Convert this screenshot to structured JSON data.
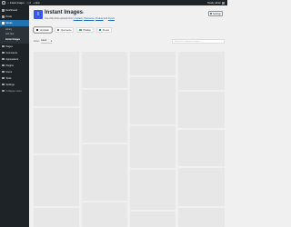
{
  "adminbar": {
    "site_name": "Instant Images",
    "comments_count": "0",
    "new_label": "+ New",
    "greeting": "Howdy, admin"
  },
  "sidebar": {
    "items": [
      {
        "label": "Dashboard",
        "icon": "dashboard-icon"
      },
      {
        "label": "Posts",
        "icon": "pin-icon"
      },
      {
        "label": "Media",
        "icon": "media-icon",
        "active": true,
        "submenu": [
          "Library",
          "Add New",
          "Instant Images"
        ],
        "current": 2
      },
      {
        "label": "Pages",
        "icon": "page-icon"
      },
      {
        "label": "Comments",
        "icon": "comment-icon"
      },
      {
        "label": "Appearance",
        "icon": "brush-icon"
      },
      {
        "label": "Plugins",
        "icon": "plug-icon"
      },
      {
        "label": "Users",
        "icon": "user-icon"
      },
      {
        "label": "Tools",
        "icon": "wrench-icon"
      },
      {
        "label": "Settings",
        "icon": "settings-icon"
      },
      {
        "label": "Collapse menu",
        "icon": "collapse-icon"
      }
    ]
  },
  "header": {
    "title": "Instant Images",
    "version": "6.0",
    "desc_prefix": "One click photo uploads from",
    "providers": [
      "Unsplash",
      "Openverse",
      "Pixabay",
      "Pexels"
    ],
    "settings_label": "Settings",
    "logo_letter": "I"
  },
  "tabs": [
    {
      "label": "Unsplash",
      "color": "#1d2327",
      "active": true
    },
    {
      "label": "Openverse",
      "color": "#6b7280",
      "active": false
    },
    {
      "label": "Pixabay",
      "color": "#2ec66d",
      "active": false
    },
    {
      "label": "Pexels",
      "color": "#05a081",
      "active": false
    }
  ],
  "toolbar": {
    "order_label": "Order:",
    "order_value": "Latest",
    "search_placeholder": "Search for Unsplash Images..."
  }
}
